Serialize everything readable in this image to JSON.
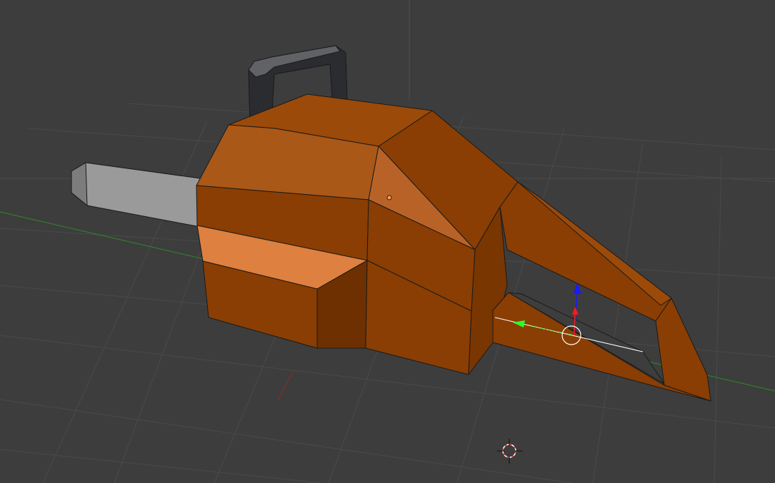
{
  "viewport": {
    "background_color": "#3d3d3d",
    "grid_color": "#4a4a4a",
    "axis_x_color": "#8b2b2b",
    "axis_y_color": "#2b8b2b"
  },
  "model": {
    "body_color": "#8a3e03",
    "body_light_color": "#b35d1d",
    "body_highlight_color": "#de8040",
    "handle_color": "#2a2c30",
    "blade_color": "#9a9a9a",
    "outline_color": "#1a1a1a"
  },
  "gizmo": {
    "z_color": "#1a1aff",
    "x_color": "#ff1a1a",
    "y_color": "#2aff2a",
    "selection_line_color": "#ffffff",
    "circle_color": "#ffffff",
    "icon": "transform-manipulator-icon"
  },
  "cursor": {
    "icon": "3d-cursor-icon"
  }
}
